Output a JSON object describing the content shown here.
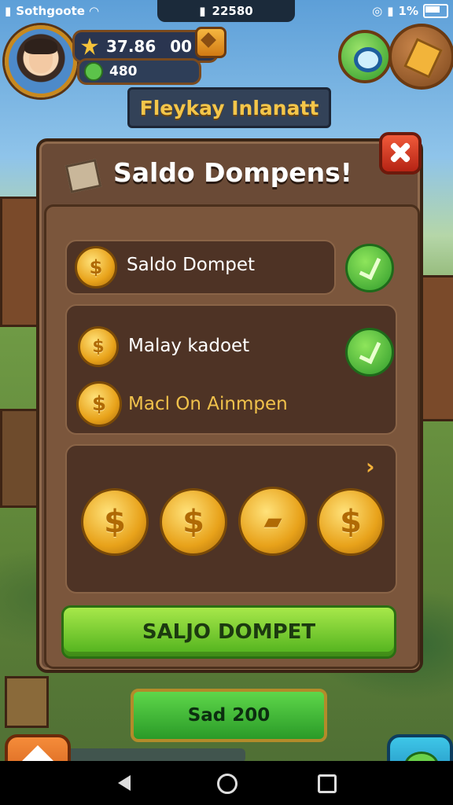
{
  "status_bar": {
    "carrier": "Sothgoote",
    "center_text": "22580",
    "battery_text": "1%"
  },
  "hud": {
    "coins": "37.86",
    "coins_extra": "00",
    "gems": "480"
  },
  "banner": {
    "title": "Fleykay Inlanatt"
  },
  "panel": {
    "title": "Saldo Dompens!",
    "rows": [
      {
        "label": "Saldo Dompet"
      },
      {
        "label": "Malay kadoet"
      },
      {
        "label": "Macl On Ainmpen"
      }
    ],
    "coins_row_icons": [
      "coin-icon",
      "coin-icon",
      "card-coin-icon",
      "coin-icon"
    ]
  },
  "buttons": {
    "primary": "SALJO DOMPET",
    "secondary": "Sad 200"
  },
  "colors": {
    "accent_green": "#4eb01c",
    "panel_brown": "#6a4a36",
    "gold": "#f1c24b",
    "close_red": "#d63a22"
  }
}
